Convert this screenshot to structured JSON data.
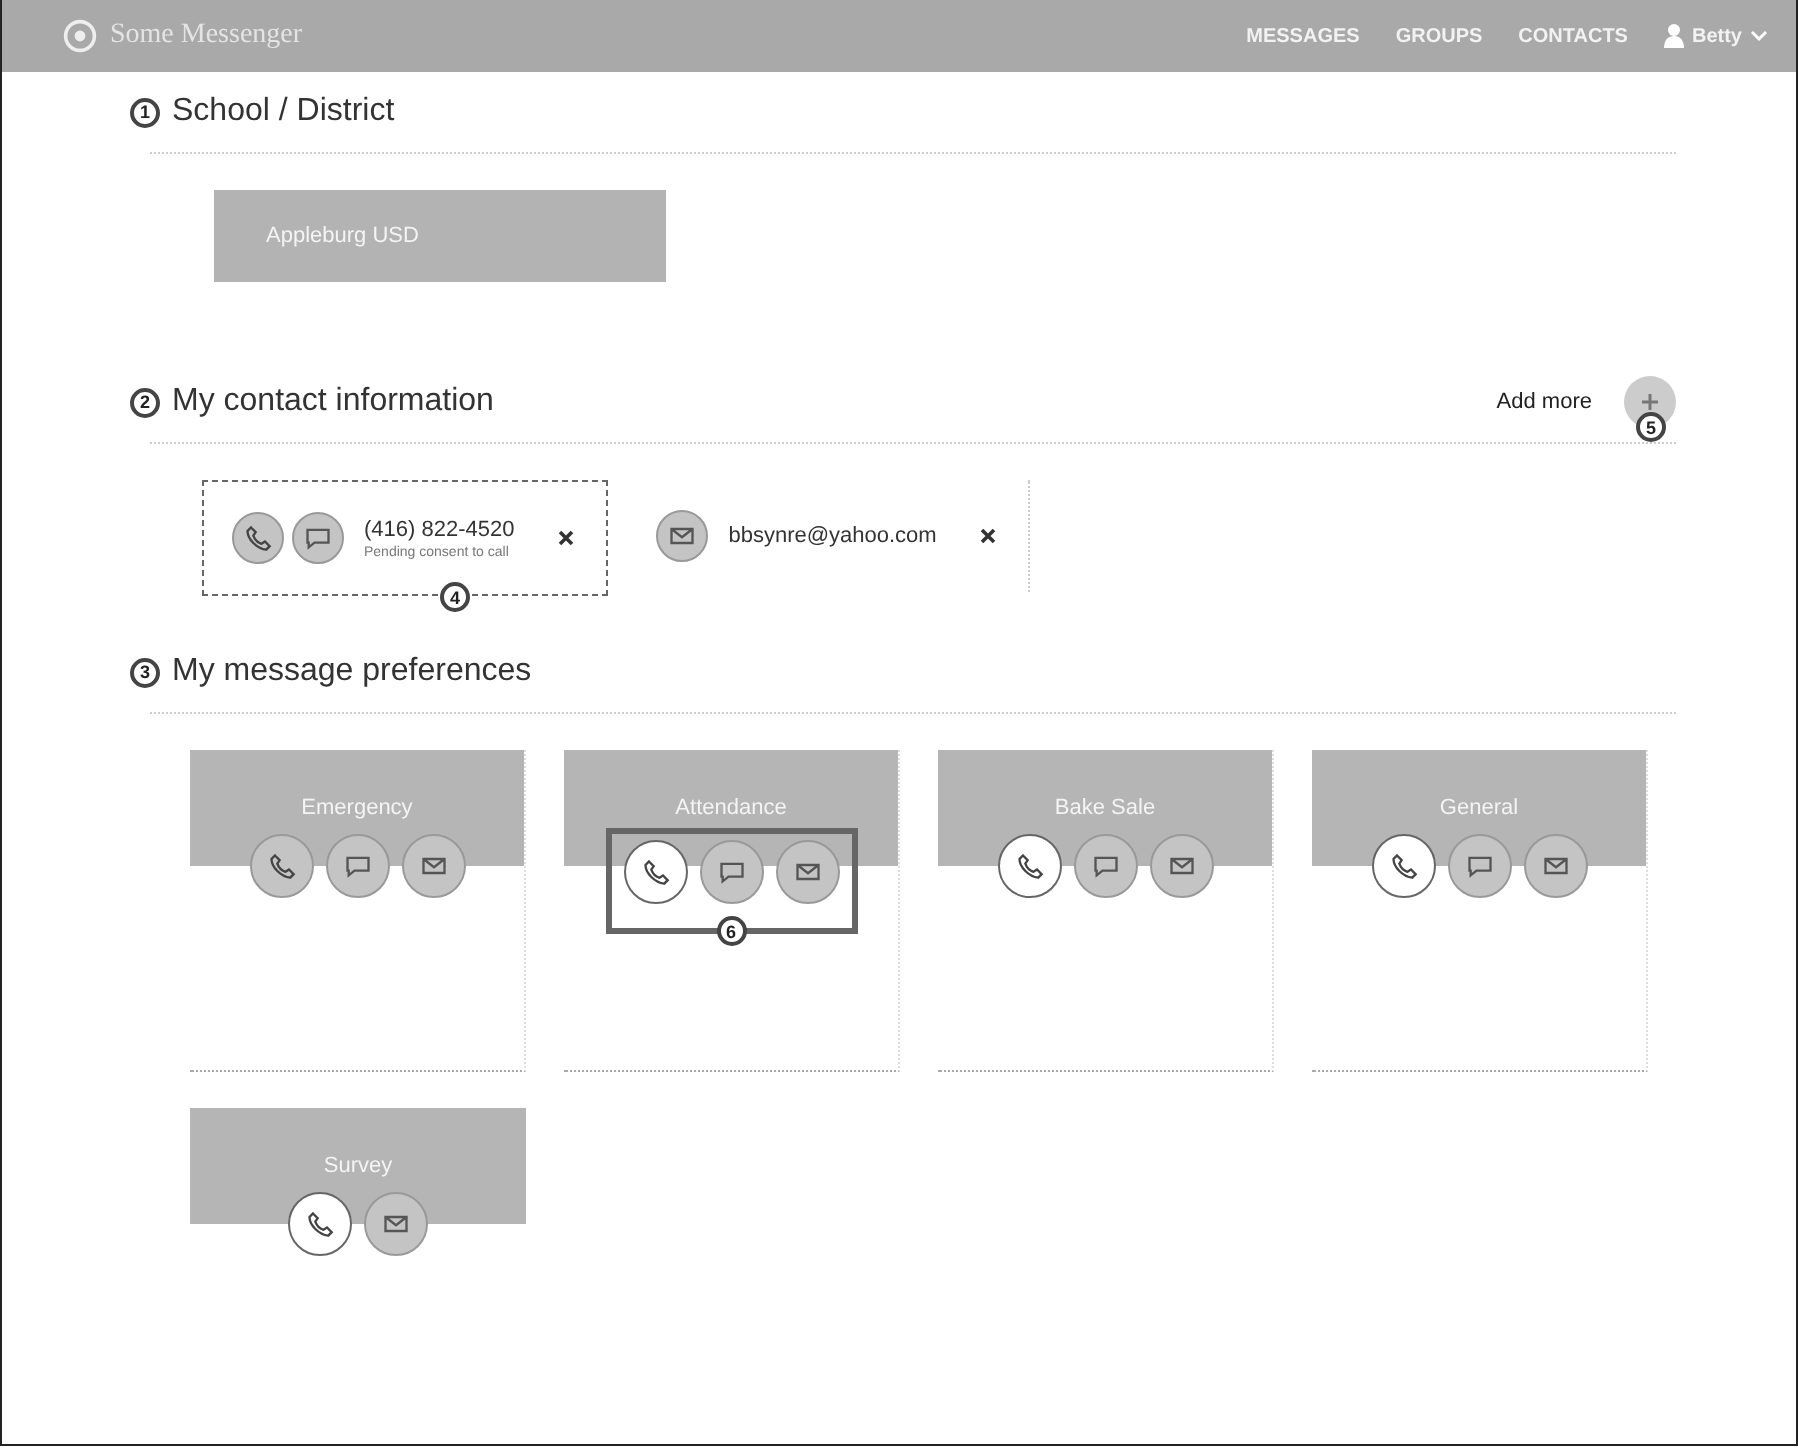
{
  "header": {
    "app_name": "Some Messenger",
    "nav": [
      {
        "label": "MESSAGES",
        "selected": false
      },
      {
        "label": "GROUPS",
        "selected": false
      },
      {
        "label": "CONTACTS",
        "selected": false
      }
    ],
    "user": "Betty"
  },
  "sections": [
    {
      "marker": "1",
      "title": "School / District"
    },
    {
      "marker": "2",
      "title": "My contact information"
    },
    {
      "marker": "3",
      "title": "My message preferences"
    }
  ],
  "school": {
    "button": "Appleburg USD"
  },
  "contact": {
    "add_more": "Add more",
    "add_marker": "5",
    "card_marker": "4",
    "items": [
      {
        "value": "(416) 822-4520",
        "note": "Pending consent to call",
        "channels": [
          {
            "kind": "call",
            "on": false
          },
          {
            "kind": "text",
            "on": false
          }
        ],
        "highlighted": true
      },
      {
        "value": "bbsynre@yahoo.com",
        "channels": [
          {
            "kind": "email",
            "on": false
          }
        ],
        "highlighted": false
      }
    ]
  },
  "preferences": {
    "marker": "6",
    "groups": [
      {
        "name": "Emergency",
        "highlighted": false,
        "channels": [
          {
            "kind": "call",
            "on": false
          },
          {
            "kind": "text",
            "on": false
          },
          {
            "kind": "email",
            "on": false
          }
        ]
      },
      {
        "name": "Attendance",
        "highlighted": true,
        "channels": [
          {
            "kind": "call",
            "on": true
          },
          {
            "kind": "text",
            "on": false
          },
          {
            "kind": "email",
            "on": false
          }
        ]
      },
      {
        "name": "Bake Sale",
        "highlighted": false,
        "channels": [
          {
            "kind": "call",
            "on": true
          },
          {
            "kind": "text",
            "on": false
          },
          {
            "kind": "email",
            "on": false
          }
        ]
      },
      {
        "name": "General",
        "highlighted": false,
        "channels": [
          {
            "kind": "call",
            "on": true
          },
          {
            "kind": "text",
            "on": false
          },
          {
            "kind": "email",
            "on": false
          }
        ]
      },
      {
        "name": "Survey",
        "highlighted": false,
        "channels": [
          {
            "kind": "call",
            "on": true
          },
          {
            "kind": "email",
            "on": false
          }
        ]
      }
    ]
  }
}
